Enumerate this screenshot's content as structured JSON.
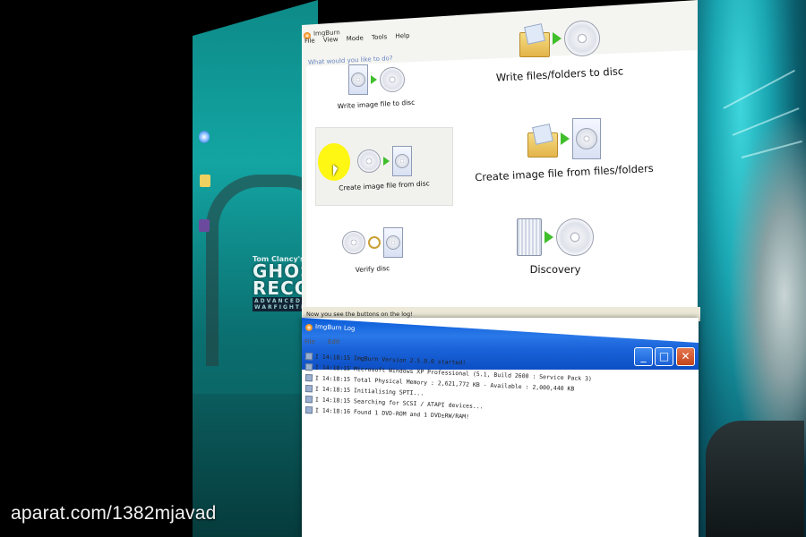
{
  "main_window": {
    "title": "ImgBurn",
    "menu": [
      "File",
      "View",
      "Mode",
      "Tools",
      "Help"
    ],
    "prompt": "What would you like to do?",
    "modes": [
      {
        "label": "Write image file to disc"
      },
      {
        "label": "Write files/folders to disc"
      },
      {
        "label": "Create image file from disc"
      },
      {
        "label": "Create image file from files/folders"
      },
      {
        "label": "Verify disc"
      },
      {
        "label": "Discovery"
      }
    ],
    "status_text": "Now you see the buttons on the log!"
  },
  "log_window": {
    "title": "ImgBurn Log",
    "menu": [
      "File",
      "Edit"
    ],
    "buttons": {
      "minimize": "_",
      "maximize": "□",
      "close": "✕"
    },
    "lines": [
      "I 14:18:15 ImgBurn Version 2.5.0.0 started!",
      "I 14:18:15 Microsoft Windows XP Professional (5.1, Build 2600 : Service Pack 3)",
      "I 14:18:15 Total Physical Memory : 2,621,772 KB  -  Available : 2,000,440 KB",
      "I 14:18:15 Initialising SPTI...",
      "I 14:18:15 Searching for SCSI / ATAPI devices...",
      "I 14:18:16 Found 1 DVD-ROM and 1 DVD±RW/RAM!"
    ]
  },
  "desktop": {
    "game_brand": "Tom Clancy's",
    "game_title_line1": "GHOST",
    "game_title_line2": "RECON",
    "game_subtitle": "ADVANCED WARFIGHTER"
  },
  "watermark": "aparat.com/1382mjavad"
}
